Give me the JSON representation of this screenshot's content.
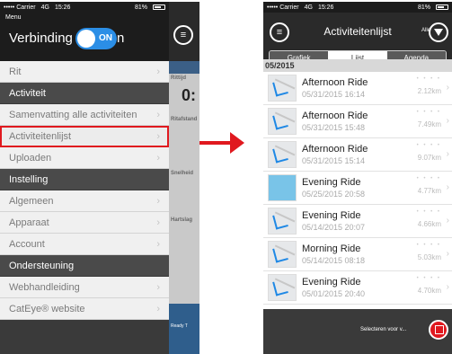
{
  "status": {
    "carrier": "••••• Carrier",
    "network": "4G",
    "time": "15:26",
    "battery": "81%"
  },
  "left": {
    "menu_label": "Menu",
    "connection_label": "Verbinding",
    "toggle_label": "ON",
    "toggle_tail": "n",
    "rows": [
      {
        "type": "item",
        "label": "Rit"
      },
      {
        "type": "section",
        "label": "Activiteit"
      },
      {
        "type": "item",
        "label": "Samenvatting alle activiteiten"
      },
      {
        "type": "item",
        "label": "Activiteitenlijst",
        "highlight": true
      },
      {
        "type": "item",
        "label": "Uploaden"
      },
      {
        "type": "section",
        "label": "Instelling"
      },
      {
        "type": "item",
        "label": "Algemeen"
      },
      {
        "type": "item",
        "label": "Apparaat"
      },
      {
        "type": "item",
        "label": "Account"
      },
      {
        "type": "section",
        "label": "Ondersteuning"
      },
      {
        "type": "item",
        "label": "Webhandleiding"
      },
      {
        "type": "item",
        "label": "CatEye® website"
      }
    ],
    "behind": {
      "ritdetail": "Rittijd",
      "time_big": "0:",
      "ritafstand": "Ritafstand",
      "snelheid": "Snelheid",
      "hartslag": "Hartslag",
      "ready": "Ready T"
    }
  },
  "right": {
    "title": "Activiteitenlijst",
    "filter_label": "Alle",
    "tabs": [
      "Grafiek",
      "Lijst",
      "Agenda"
    ],
    "active_tab": 1,
    "period": "05/2015",
    "activities": [
      {
        "name": "Afternoon Ride",
        "date": "05/31/2015 16:14",
        "distance": "2.12km",
        "thumb": "map"
      },
      {
        "name": "Afternoon Ride",
        "date": "05/31/2015 15:48",
        "distance": "7.49km",
        "thumb": "map"
      },
      {
        "name": "Afternoon Ride",
        "date": "05/31/2015 15:14",
        "distance": "9.07km",
        "thumb": "map"
      },
      {
        "name": "Evening Ride",
        "date": "05/25/2015 20:58",
        "distance": "4.77km",
        "thumb": "water"
      },
      {
        "name": "Evening Ride",
        "date": "05/14/2015 20:07",
        "distance": "4.66km",
        "thumb": "map"
      },
      {
        "name": "Morning Ride",
        "date": "05/14/2015 08:18",
        "distance": "5.03km",
        "thumb": "map"
      },
      {
        "name": "Evening Ride",
        "date": "05/01/2015 20:40",
        "distance": "4.70km",
        "thumb": "map"
      }
    ],
    "footer_label": "Selecteren voor v...",
    "accent": "#e0191f"
  }
}
